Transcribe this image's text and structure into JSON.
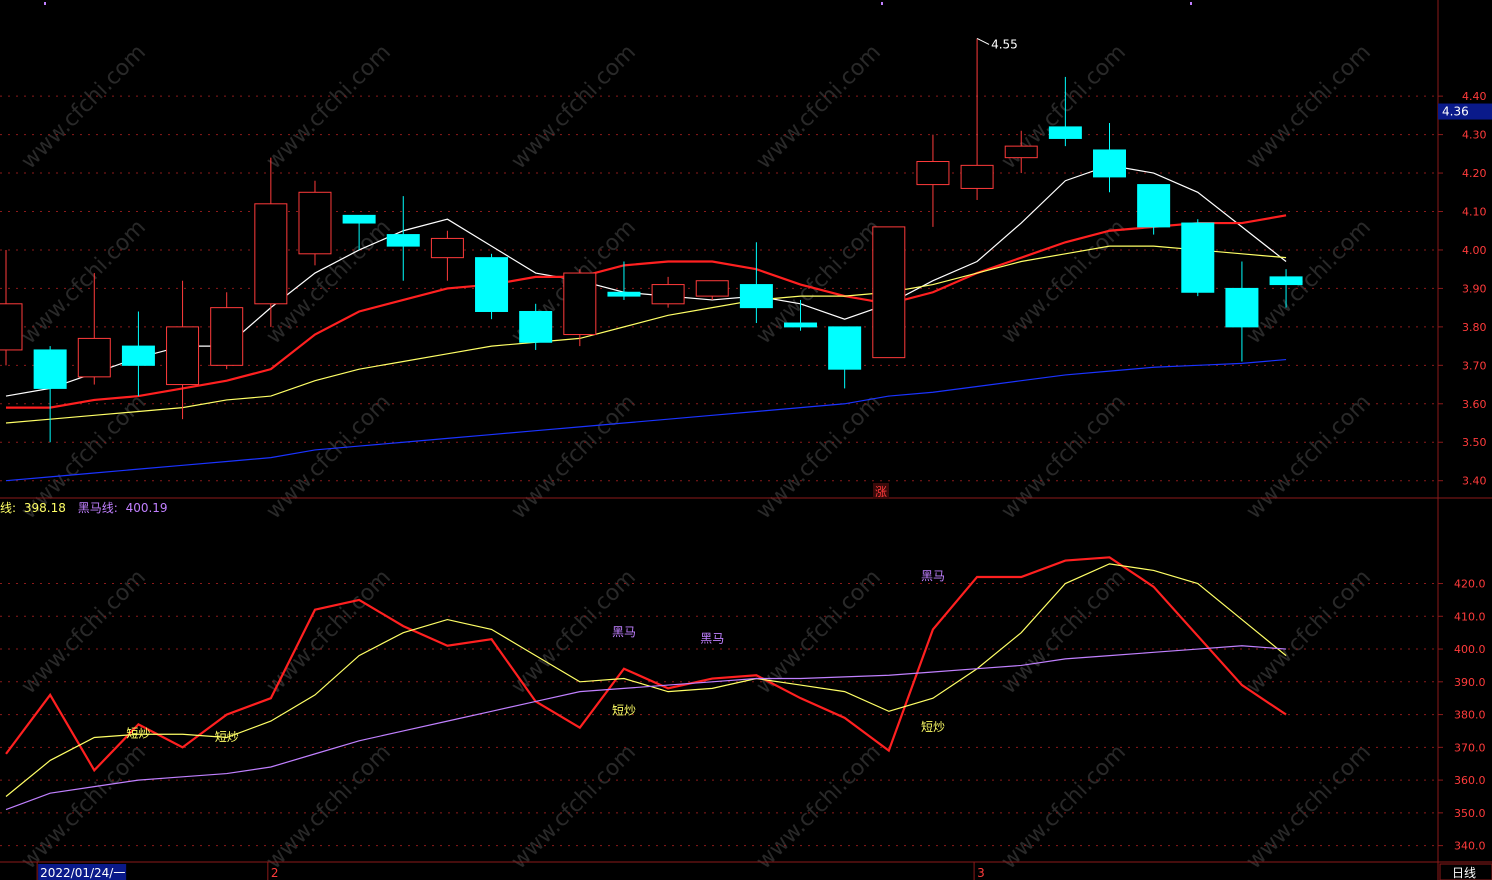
{
  "colors": {
    "background": "#000000",
    "up": "#ff3b3b",
    "down": "#00ffff",
    "ma_white": "#ffffff",
    "ma_red": "#ff2020",
    "ma_yellow": "#ffff66",
    "ma_blue": "#1a33ff",
    "osc_yellow": "#ffff66",
    "osc_purple": "#c080ff",
    "grid": "#8b1a1a",
    "axis_text": "#ff3b3b",
    "watermark": "#444444"
  },
  "watermark_text": "www.cfchi.com",
  "price_panel": {
    "y_range": [
      3.355,
      4.65
    ],
    "ticks": [
      3.4,
      3.5,
      3.6,
      3.7,
      3.8,
      3.9,
      4.0,
      4.1,
      4.2,
      4.3,
      4.4
    ],
    "tick_labels": [
      "3.40",
      "3.50",
      "3.60",
      "3.70",
      "3.80",
      "3.90",
      "4.00",
      "4.10",
      "4.20",
      "4.30",
      "4.40"
    ],
    "current_price_label": "4.36",
    "current_price": 4.36,
    "max_label": "4.55",
    "max_value": 4.55,
    "zhang_label": "涨"
  },
  "osc_panel": {
    "y_range": [
      335,
      440
    ],
    "ticks": [
      340,
      350,
      360,
      370,
      380,
      390,
      400,
      410,
      420
    ],
    "tick_labels": [
      "340.0",
      "350.0",
      "360.0",
      "370.0",
      "380.0",
      "390.0",
      "400.0",
      "410.0",
      "420.0"
    ],
    "legend": {
      "partial_label": "线:",
      "partial_value": "398.18",
      "heima_label": "黑马线:",
      "heima_value": "400.19"
    },
    "annotations": [
      {
        "text": "短炒",
        "idx": 3,
        "value": 373,
        "color": "yellow"
      },
      {
        "text": "短炒",
        "idx": 5,
        "value": 372,
        "color": "yellow"
      },
      {
        "text": "黑马",
        "idx": 14,
        "value": 404,
        "color": "purple"
      },
      {
        "text": "短炒",
        "idx": 14,
        "value": 380,
        "color": "yellow"
      },
      {
        "text": "黑马",
        "idx": 16,
        "value": 402,
        "color": "purple"
      },
      {
        "text": "黑马",
        "idx": 21,
        "value": 421,
        "color": "purple"
      },
      {
        "text": "短炒",
        "idx": 21,
        "value": 375,
        "color": "yellow"
      }
    ]
  },
  "x_axis": {
    "labels": [
      {
        "text": "2022/01/24/一",
        "idx": 1,
        "highlight": true
      },
      {
        "text": "2",
        "idx": 6,
        "highlight": false
      },
      {
        "text": "3",
        "idx": 22,
        "highlight": false
      }
    ],
    "period_label": "日线"
  },
  "chart_data": {
    "type": "candlestick",
    "candles": [
      {
        "o": 3.74,
        "h": 4.0,
        "l": 3.7,
        "c": 3.86
      },
      {
        "o": 3.74,
        "h": 3.75,
        "l": 3.5,
        "c": 3.64
      },
      {
        "o": 3.67,
        "h": 3.94,
        "l": 3.65,
        "c": 3.77
      },
      {
        "o": 3.75,
        "h": 3.84,
        "l": 3.62,
        "c": 3.7
      },
      {
        "o": 3.65,
        "h": 3.92,
        "l": 3.56,
        "c": 3.8
      },
      {
        "o": 3.7,
        "h": 3.89,
        "l": 3.69,
        "c": 3.85
      },
      {
        "o": 3.86,
        "h": 4.24,
        "l": 3.8,
        "c": 4.12
      },
      {
        "o": 3.99,
        "h": 4.18,
        "l": 3.96,
        "c": 4.15
      },
      {
        "o": 4.09,
        "h": 4.09,
        "l": 4.0,
        "c": 4.07
      },
      {
        "o": 4.04,
        "h": 4.14,
        "l": 3.92,
        "c": 4.01
      },
      {
        "o": 3.98,
        "h": 4.05,
        "l": 3.92,
        "c": 4.03
      },
      {
        "o": 3.98,
        "h": 3.99,
        "l": 3.82,
        "c": 3.84
      },
      {
        "o": 3.84,
        "h": 3.86,
        "l": 3.74,
        "c": 3.76
      },
      {
        "o": 3.78,
        "h": 3.95,
        "l": 3.75,
        "c": 3.94
      },
      {
        "o": 3.89,
        "h": 3.97,
        "l": 3.87,
        "c": 3.88
      },
      {
        "o": 3.86,
        "h": 3.93,
        "l": 3.85,
        "c": 3.91
      },
      {
        "o": 3.88,
        "h": 3.92,
        "l": 3.87,
        "c": 3.92
      },
      {
        "o": 3.91,
        "h": 4.02,
        "l": 3.81,
        "c": 3.85
      },
      {
        "o": 3.81,
        "h": 3.87,
        "l": 3.79,
        "c": 3.8
      },
      {
        "o": 3.8,
        "h": 3.8,
        "l": 3.64,
        "c": 3.69
      },
      {
        "o": 3.72,
        "h": 4.06,
        "l": 3.72,
        "c": 4.06
      },
      {
        "o": 4.17,
        "h": 4.3,
        "l": 4.06,
        "c": 4.23
      },
      {
        "o": 4.16,
        "h": 4.55,
        "l": 4.13,
        "c": 4.22
      },
      {
        "o": 4.24,
        "h": 4.31,
        "l": 4.2,
        "c": 4.27
      },
      {
        "o": 4.32,
        "h": 4.45,
        "l": 4.27,
        "c": 4.29
      },
      {
        "o": 4.26,
        "h": 4.33,
        "l": 4.15,
        "c": 4.19
      },
      {
        "o": 4.17,
        "h": 4.17,
        "l": 4.04,
        "c": 4.06
      },
      {
        "o": 4.07,
        "h": 4.08,
        "l": 3.88,
        "c": 3.89
      },
      {
        "o": 3.9,
        "h": 3.97,
        "l": 3.71,
        "c": 3.8
      },
      {
        "o": 3.93,
        "h": 3.95,
        "l": 3.85,
        "c": 3.91
      }
    ],
    "ma_series": [
      {
        "color": "ma_white",
        "values": [
          3.62,
          3.64,
          3.68,
          3.72,
          3.75,
          3.75,
          3.85,
          3.94,
          4.0,
          4.05,
          4.08,
          4.01,
          3.94,
          3.92,
          3.89,
          3.88,
          3.87,
          3.88,
          3.86,
          3.82,
          3.86,
          3.92,
          3.97,
          4.07,
          4.18,
          4.22,
          4.2,
          4.15,
          4.06,
          3.97
        ]
      },
      {
        "color": "ma_red",
        "values": [
          3.59,
          3.59,
          3.61,
          3.62,
          3.64,
          3.66,
          3.69,
          3.78,
          3.84,
          3.87,
          3.9,
          3.91,
          3.93,
          3.93,
          3.96,
          3.97,
          3.97,
          3.95,
          3.91,
          3.88,
          3.86,
          3.89,
          3.94,
          3.98,
          4.02,
          4.05,
          4.06,
          4.07,
          4.07,
          4.09
        ]
      },
      {
        "color": "ma_yellow",
        "values": [
          3.55,
          3.56,
          3.57,
          3.58,
          3.59,
          3.61,
          3.62,
          3.66,
          3.69,
          3.71,
          3.73,
          3.75,
          3.76,
          3.77,
          3.8,
          3.83,
          3.85,
          3.87,
          3.88,
          3.88,
          3.89,
          3.91,
          3.94,
          3.97,
          3.99,
          4.01,
          4.01,
          4.0,
          3.99,
          3.98
        ]
      },
      {
        "color": "ma_blue",
        "values": [
          3.4,
          3.41,
          3.42,
          3.43,
          3.44,
          3.45,
          3.46,
          3.48,
          3.49,
          3.5,
          3.51,
          3.52,
          3.53,
          3.54,
          3.55,
          3.56,
          3.57,
          3.58,
          3.59,
          3.6,
          3.62,
          3.63,
          3.645,
          3.66,
          3.675,
          3.685,
          3.695,
          3.7,
          3.705,
          3.715
        ]
      }
    ],
    "osc_series": [
      {
        "name": "",
        "color": "ma_red",
        "values": [
          368,
          386,
          363,
          377,
          370,
          380,
          385,
          412,
          415,
          407,
          401,
          403,
          384,
          376,
          394,
          388,
          391,
          392,
          385,
          379,
          369,
          406,
          422,
          422,
          427,
          428,
          419,
          404,
          389,
          380
        ]
      },
      {
        "name": "",
        "color": "osc_yellow",
        "values": [
          355,
          366,
          373,
          374,
          374,
          373,
          378,
          386,
          398,
          405,
          409,
          406,
          398,
          390,
          391,
          387,
          388,
          391,
          389,
          387,
          381,
          385,
          394,
          405,
          420,
          426,
          424,
          420,
          409,
          398
        ]
      },
      {
        "name": "黑马线",
        "color": "osc_purple",
        "values": [
          351,
          356,
          358,
          360,
          361,
          362,
          364,
          368,
          372,
          375,
          378,
          381,
          384,
          387,
          388,
          389,
          390,
          391,
          391,
          391.5,
          392,
          393,
          394,
          395,
          397,
          398,
          399,
          400,
          401,
          400
        ]
      }
    ]
  }
}
